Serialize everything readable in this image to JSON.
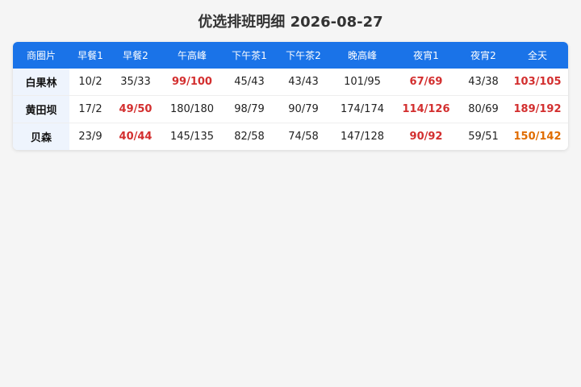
{
  "title": "优选排班明细 2026-08-27",
  "colors": {
    "header_bg": "#1a73e8",
    "store_bg": "#eef4fd",
    "alert_red": "#d32f2f",
    "warn_orange": "#e06c00"
  },
  "table": {
    "headers": [
      "商圈片",
      "早餐1",
      "早餐2",
      "午高峰",
      "下午茶1",
      "下午茶2",
      "晚高峰",
      "夜宵1",
      "夜宵2",
      "全天"
    ],
    "rows": [
      {
        "store": "白果林",
        "cells": [
          {
            "value": "10/2",
            "status": "normal"
          },
          {
            "value": "35/33",
            "status": "normal"
          },
          {
            "value": "99/100",
            "status": "red"
          },
          {
            "value": "45/43",
            "status": "normal"
          },
          {
            "value": "43/43",
            "status": "normal"
          },
          {
            "value": "101/95",
            "status": "normal"
          },
          {
            "value": "67/69",
            "status": "red"
          },
          {
            "value": "43/38",
            "status": "normal"
          },
          {
            "value": "103/105",
            "status": "red"
          }
        ]
      },
      {
        "store": "黄田坝",
        "cells": [
          {
            "value": "17/2",
            "status": "normal"
          },
          {
            "value": "49/50",
            "status": "red"
          },
          {
            "value": "180/180",
            "status": "normal"
          },
          {
            "value": "98/79",
            "status": "normal"
          },
          {
            "value": "90/79",
            "status": "normal"
          },
          {
            "value": "174/174",
            "status": "normal"
          },
          {
            "value": "114/126",
            "status": "red"
          },
          {
            "value": "80/69",
            "status": "normal"
          },
          {
            "value": "189/192",
            "status": "red"
          }
        ]
      },
      {
        "store": "贝森",
        "cells": [
          {
            "value": "23/9",
            "status": "normal"
          },
          {
            "value": "40/44",
            "status": "red"
          },
          {
            "value": "145/135",
            "status": "normal"
          },
          {
            "value": "82/58",
            "status": "normal"
          },
          {
            "value": "74/58",
            "status": "normal"
          },
          {
            "value": "147/128",
            "status": "normal"
          },
          {
            "value": "90/92",
            "status": "red"
          },
          {
            "value": "59/51",
            "status": "normal"
          },
          {
            "value": "150/142",
            "status": "orange"
          }
        ]
      }
    ]
  }
}
